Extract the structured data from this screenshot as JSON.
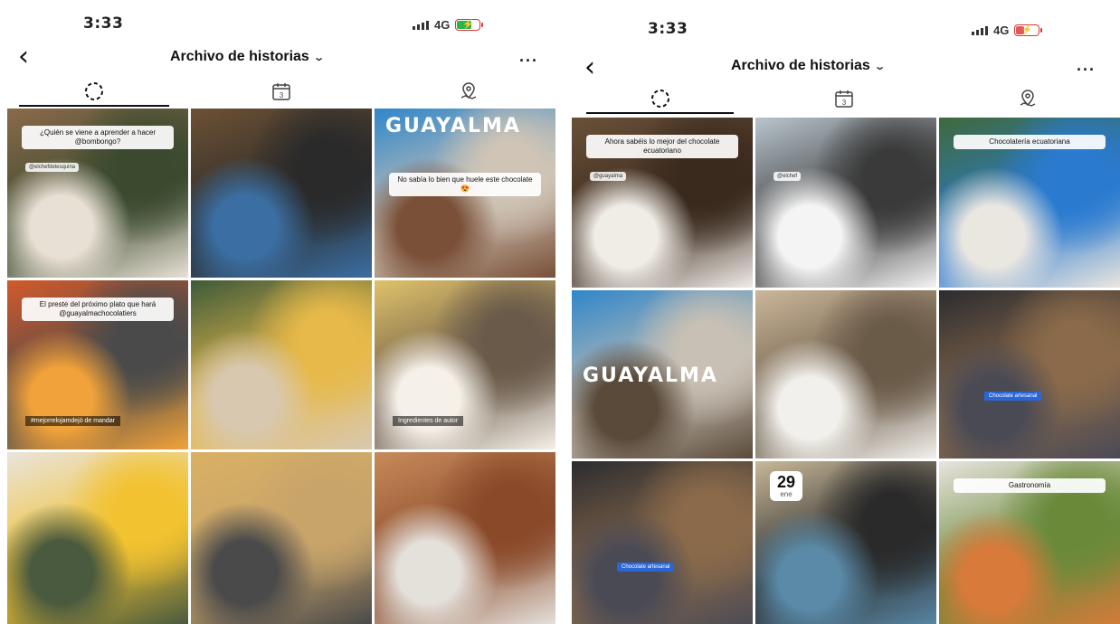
{
  "screens": [
    {
      "status": {
        "time": "3:33",
        "network": "4G"
      },
      "header": {
        "title": "Archivo de historias",
        "more_label": "..."
      },
      "tabs": [
        "stories-icon",
        "calendar-icon",
        "map-icon"
      ],
      "calendar_day": "3",
      "cells": [
        {
          "caption": "¿Quién se viene a aprender a hacer @bombongo?",
          "tag": "@elchefdelesquina",
          "colors": [
            "#8a6a4a",
            "#e8e0d4",
            "#3b4a2f"
          ]
        },
        {
          "colors": [
            "#6d5134",
            "#3b6fa3",
            "#2a2a2a"
          ]
        },
        {
          "brand": "GUAYALMA",
          "caption": "No sabía lo bien que huele este chocolate 😍",
          "colors": [
            "#2f86c9",
            "#7a5038",
            "#cfc4b6"
          ]
        },
        {
          "caption": "El preste del próximo plato que hará @guayalmachocolatiers",
          "darkcap": "#mejorrelojamdejó de mandar",
          "colors": [
            "#d35a2b",
            "#f2a23a",
            "#4a4a4a"
          ]
        },
        {
          "colors": [
            "#3e5a3a",
            "#d8c8b0",
            "#e7b94a"
          ]
        },
        {
          "darkcap": "Ingredientes de autor",
          "colors": [
            "#e0c26a",
            "#f5f0e8",
            "#6a5a4a"
          ]
        },
        {
          "colors": [
            "#e9e4dc",
            "#4a5a3f",
            "#f2c230"
          ]
        },
        {
          "colors": [
            "#d9b064",
            "#4a4a4a",
            "#c8a46a"
          ]
        },
        {
          "colors": [
            "#c78a5a",
            "#e4e0da",
            "#8a4a2a"
          ]
        }
      ]
    },
    {
      "status": {
        "time": "3:33",
        "network": "4G"
      },
      "header": {
        "title": "Archivo de historias",
        "more_label": "..."
      },
      "tabs": [
        "stories-icon",
        "calendar-icon",
        "map-icon"
      ],
      "calendar_day": "3",
      "cells": [
        {
          "caption": "Ahora sabéis lo mejor del chocolate ecuatoriano",
          "tag": "@guayalma",
          "colors": [
            "#6a5038",
            "#f0ece6",
            "#3a2a1e"
          ]
        },
        {
          "tag": "@elchef",
          "colors": [
            "#b8c4cc",
            "#f4f4f4",
            "#3a3a3a"
          ]
        },
        {
          "caption": "Chocolatería ecuatoriana",
          "colors": [
            "#3f6a3a",
            "#eae6e0",
            "#2a7ad0"
          ]
        },
        {
          "brand": "GUAYALMA",
          "colors": [
            "#2f86c9",
            "#5a4a3a",
            "#c8c0b4"
          ]
        },
        {
          "colors": [
            "#cbb79a",
            "#f2f0ec",
            "#6a5a48"
          ]
        },
        {
          "bluebar": "Chocolate artesanal",
          "colors": [
            "#2c2c30",
            "#4a4a55",
            "#8a6a4a"
          ]
        },
        {
          "bluebar": "Chocolate artesanal",
          "colors": [
            "#2c2c30",
            "#4a4a55",
            "#8a6a4a"
          ]
        },
        {
          "date_day": "29",
          "date_month": "ene",
          "colors": [
            "#c8b898",
            "#5a8aa8",
            "#2a2a2a"
          ]
        },
        {
          "caption": "Gastronomía",
          "colors": [
            "#e8e4de",
            "#d87a3a",
            "#6a8a3a"
          ]
        }
      ]
    }
  ]
}
